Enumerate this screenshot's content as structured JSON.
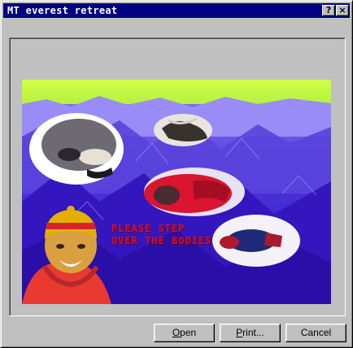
{
  "window": {
    "title": "MT everest retreat",
    "help_glyph": "?",
    "close_glyph": "×"
  },
  "image": {
    "caption": "PLEASE STEP OVER THE BODIES",
    "colors": {
      "sky": "#c8ff3a",
      "mountain": "#3a22c8",
      "mountain_light": "#7a6af0",
      "jacket_red": "#e01830"
    }
  },
  "buttons": {
    "open": {
      "accel": "O",
      "rest": "pen"
    },
    "print": {
      "accel": "P",
      "rest": "rint..."
    },
    "cancel": {
      "label": "Cancel"
    }
  }
}
